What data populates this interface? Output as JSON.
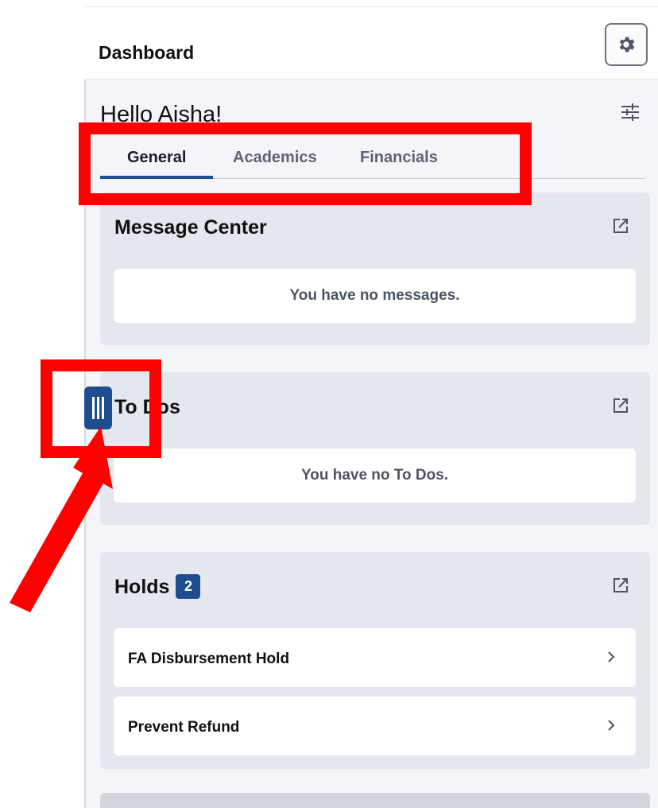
{
  "header": {
    "title": "Dashboard",
    "settings_icon": "gear-icon"
  },
  "greeting": "Hello Aisha!",
  "filter_icon": "sliders-icon",
  "tabs": [
    {
      "label": "General",
      "active": true
    },
    {
      "label": "Academics",
      "active": false
    },
    {
      "label": "Financials",
      "active": false
    }
  ],
  "message_center": {
    "title": "Message Center",
    "empty_text": "You have no messages."
  },
  "todos": {
    "title": "To Dos",
    "empty_text": "You have no To Dos."
  },
  "holds": {
    "title": "Holds",
    "count": "2",
    "items": [
      {
        "label": "FA Disbursement Hold"
      },
      {
        "label": "Prevent Refund"
      }
    ]
  },
  "colors": {
    "accent": "#1e4d8f",
    "annotation": "#ff0000",
    "card_bg": "#e5e7ef",
    "page_bg": "#f4f5f8"
  }
}
